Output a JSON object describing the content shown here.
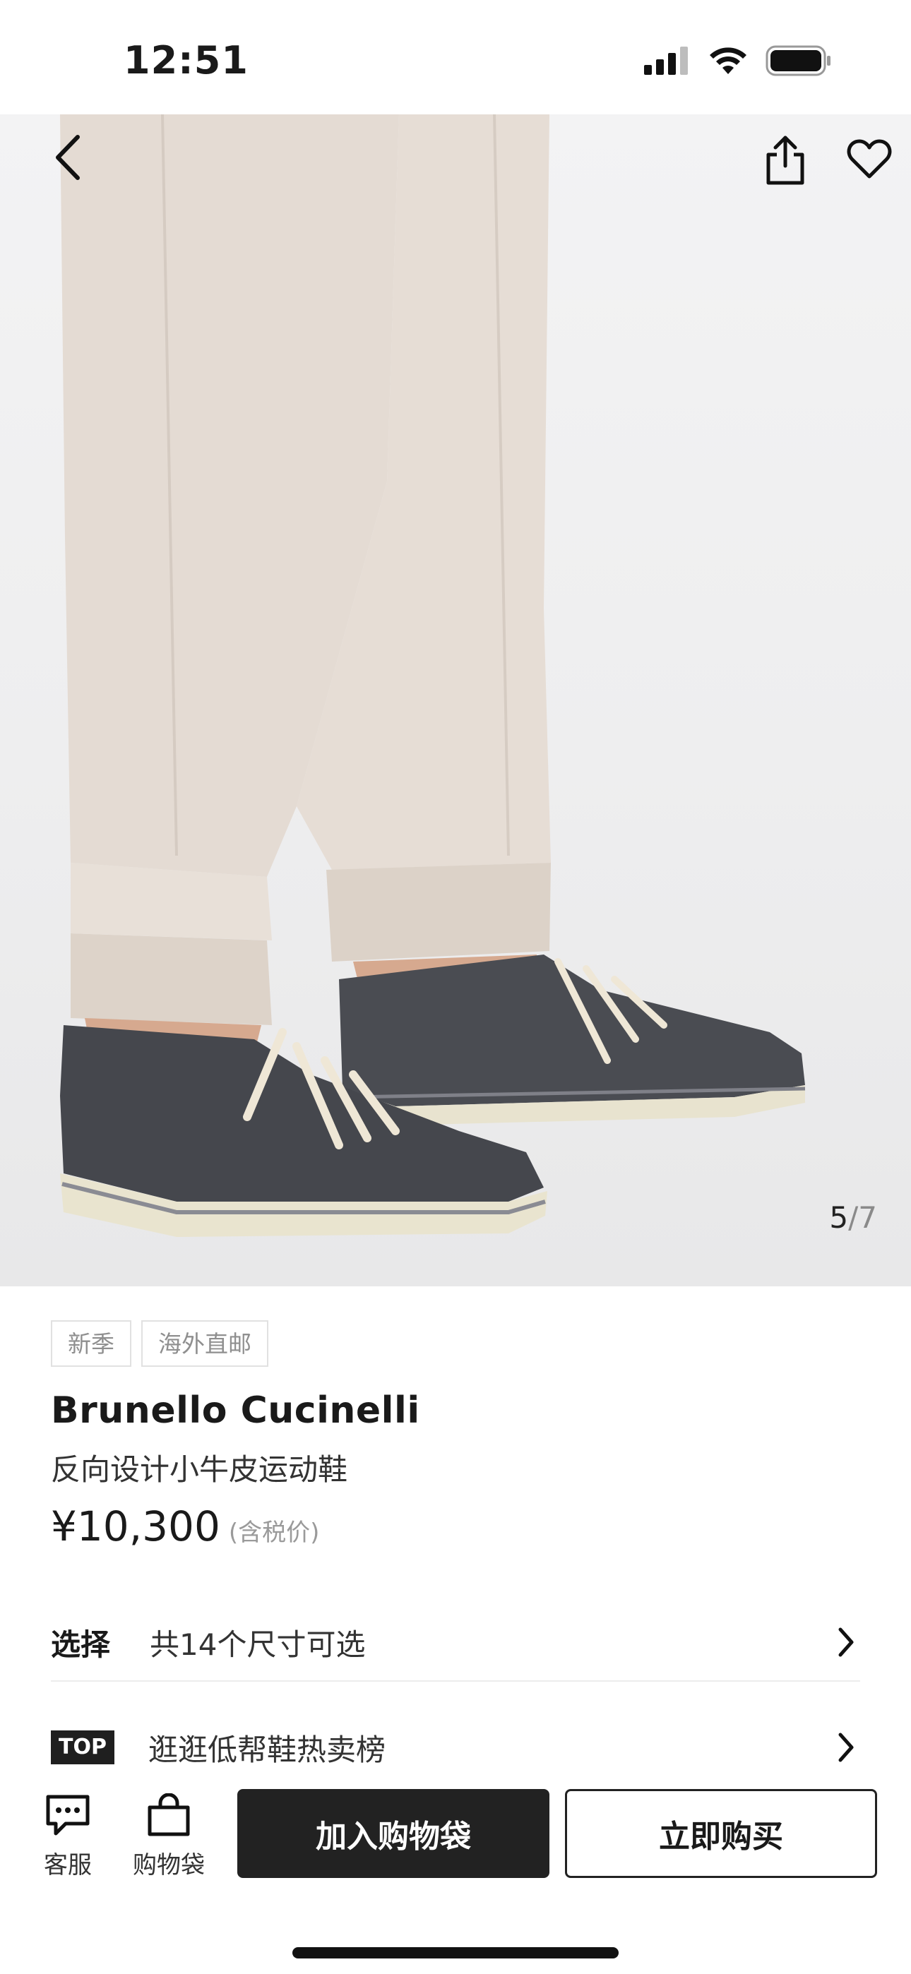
{
  "status_bar": {
    "time": "12:51"
  },
  "gallery": {
    "current_index": "5",
    "separator": "/",
    "total": "7"
  },
  "product": {
    "tags": [
      "新季",
      "海外直邮"
    ],
    "brand": "Brunello Cucinelli",
    "name": "反向设计小牛皮运动鞋",
    "price": "¥10,300",
    "tax_note": "(含税价)"
  },
  "size_row": {
    "label": "选择",
    "text": "共14个尺寸可选"
  },
  "top_row": {
    "badge": "TOP",
    "text": "逛逛低帮鞋热卖榜"
  },
  "bottom_bar": {
    "service_label": "客服",
    "bag_label": "购物袋",
    "add_to_bag": "加入购物袋",
    "buy_now": "立即购买"
  },
  "icons": [
    "back-arrow-icon",
    "share-icon",
    "heart-icon",
    "chat-icon",
    "shopping-bag-icon",
    "chevron-right-icon",
    "signal-icon",
    "wifi-icon",
    "battery-icon"
  ]
}
